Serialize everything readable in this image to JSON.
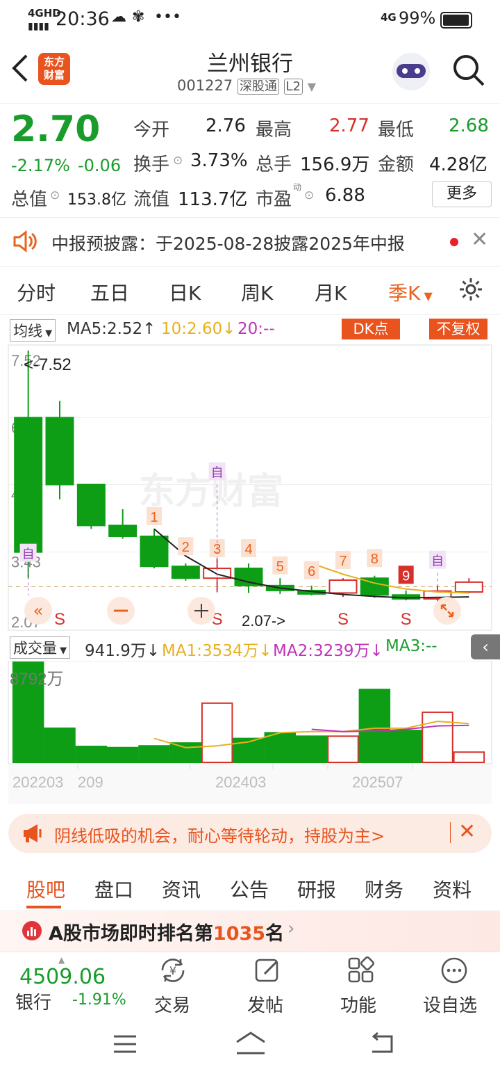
{
  "status": {
    "time": "20:36",
    "network": "4GHD",
    "battery": "99%",
    "net2": "4G"
  },
  "header": {
    "logo_line1": "东方",
    "logo_line2": "财富",
    "title": "兰州银行",
    "code": "001227",
    "tag": "深股通",
    "level": "L2"
  },
  "quote": {
    "price": "2.70",
    "pct": "-2.17%",
    "chg": "-0.06",
    "open_label": "今开",
    "open": "2.76",
    "high_label": "最高",
    "high": "2.77",
    "low_label": "最低",
    "low": "2.68",
    "turnover_label": "换手",
    "turnover": "3.73%",
    "volume_label": "总手",
    "volume": "156.9万",
    "amount_label": "金额",
    "amount": "4.28亿",
    "mcap_label": "总值",
    "mcap": "153.8亿",
    "float_label": "流值",
    "float": "113.7亿",
    "pe_label": "市盈",
    "pe_sup": "动",
    "pe": "6.88",
    "more": "更多"
  },
  "notice": {
    "text": "中报预披露：于2025-08-28披露2025年中报"
  },
  "tabs": [
    "分时",
    "五日",
    "日K",
    "周K",
    "月K",
    "季K"
  ],
  "ma": {
    "selector": "均线",
    "ma5": "MA5:2.52",
    "ma10": "10:2.60",
    "ma20": "20:--",
    "dk": "DK点",
    "fq": "不复权"
  },
  "chart_data": {
    "type": "candlestick",
    "period": "quarterly",
    "y_ticks": [
      "7.52",
      "6.16",
      "4.80",
      "3.43",
      "2.07"
    ],
    "ylim": [
      2.07,
      7.52
    ],
    "max_label": "<-7.52",
    "min_label": "2.07->",
    "candles": [
      [
        6.16,
        3.43,
        7.52,
        2.9
      ],
      [
        6.16,
        4.8,
        6.5,
        4.5
      ],
      [
        4.8,
        3.97,
        4.8,
        3.9
      ],
      [
        3.97,
        3.75,
        4.3,
        3.7
      ],
      [
        3.75,
        3.14,
        3.9,
        3.1
      ],
      [
        3.14,
        2.9,
        3.2,
        2.85
      ],
      [
        2.9,
        3.1,
        3.3,
        2.62
      ],
      [
        3.1,
        2.75,
        3.2,
        2.6
      ],
      [
        2.75,
        2.65,
        2.9,
        2.58
      ],
      [
        2.65,
        2.58,
        2.75,
        2.55
      ],
      [
        2.6,
        2.86,
        2.9,
        2.52
      ],
      [
        2.9,
        2.56,
        2.95,
        2.5
      ],
      [
        2.56,
        2.48,
        2.65,
        2.45
      ],
      [
        2.48,
        2.64,
        2.75,
        2.4
      ],
      [
        2.62,
        2.82,
        2.9,
        2.6
      ]
    ],
    "ma_line": [
      null,
      null,
      null,
      null,
      3.9,
      3.35,
      2.98,
      2.82,
      2.7,
      2.63,
      2.57,
      2.53,
      2.5,
      2.51,
      2.52
    ],
    "ma10_line": [
      null,
      null,
      null,
      null,
      null,
      null,
      null,
      null,
      null,
      3.2,
      2.98,
      2.8,
      2.68,
      2.62,
      2.6
    ],
    "markers": [
      "1",
      "2",
      "3",
      "4",
      "5",
      "6",
      "7",
      "8",
      "9"
    ],
    "s_label": "S",
    "zi": "自",
    "volume_label": "成交量",
    "volume_current": "941.9万",
    "vma1": "MA1:3534万",
    "vma2": "MA2:3239万",
    "vma3": "MA3:--",
    "volume_max": "8792万",
    "volumes": [
      8792,
      3000,
      1400,
      1300,
      1450,
      1700,
      5200,
      2100,
      2600,
      2300,
      2300,
      6400,
      2800,
      4400,
      900
    ],
    "vma1_line": [
      null,
      null,
      null,
      null,
      2100,
      1300,
      1450,
      1800,
      2600,
      2700,
      2700,
      3000,
      3000,
      3600,
      3400
    ],
    "vma2_line": [
      null,
      null,
      null,
      null,
      null,
      null,
      null,
      null,
      null,
      2900,
      2700,
      2750,
      2900,
      3200,
      3250
    ],
    "x_labels": [
      "202203",
      "209",
      "202403",
      "202507"
    ]
  },
  "tip": {
    "text": "阴线低吸的机会，耐心等待轮动，持股为主>"
  },
  "bottom_tabs": [
    "股吧",
    "盘口",
    "资讯",
    "公告",
    "研报",
    "财务",
    "资料"
  ],
  "rank": {
    "prefix": "A股市场即时排名第",
    "num": "1035",
    "suffix": "名"
  },
  "dock": {
    "index_val": "4509.06",
    "index_name": "银行",
    "index_pct": "-1.91%",
    "trade": "交易",
    "post": "发帖",
    "func": "功能",
    "watch": "设自选"
  },
  "colors": {
    "up": "#d6302a",
    "down": "#0d9e16",
    "accent": "#e8631e"
  }
}
